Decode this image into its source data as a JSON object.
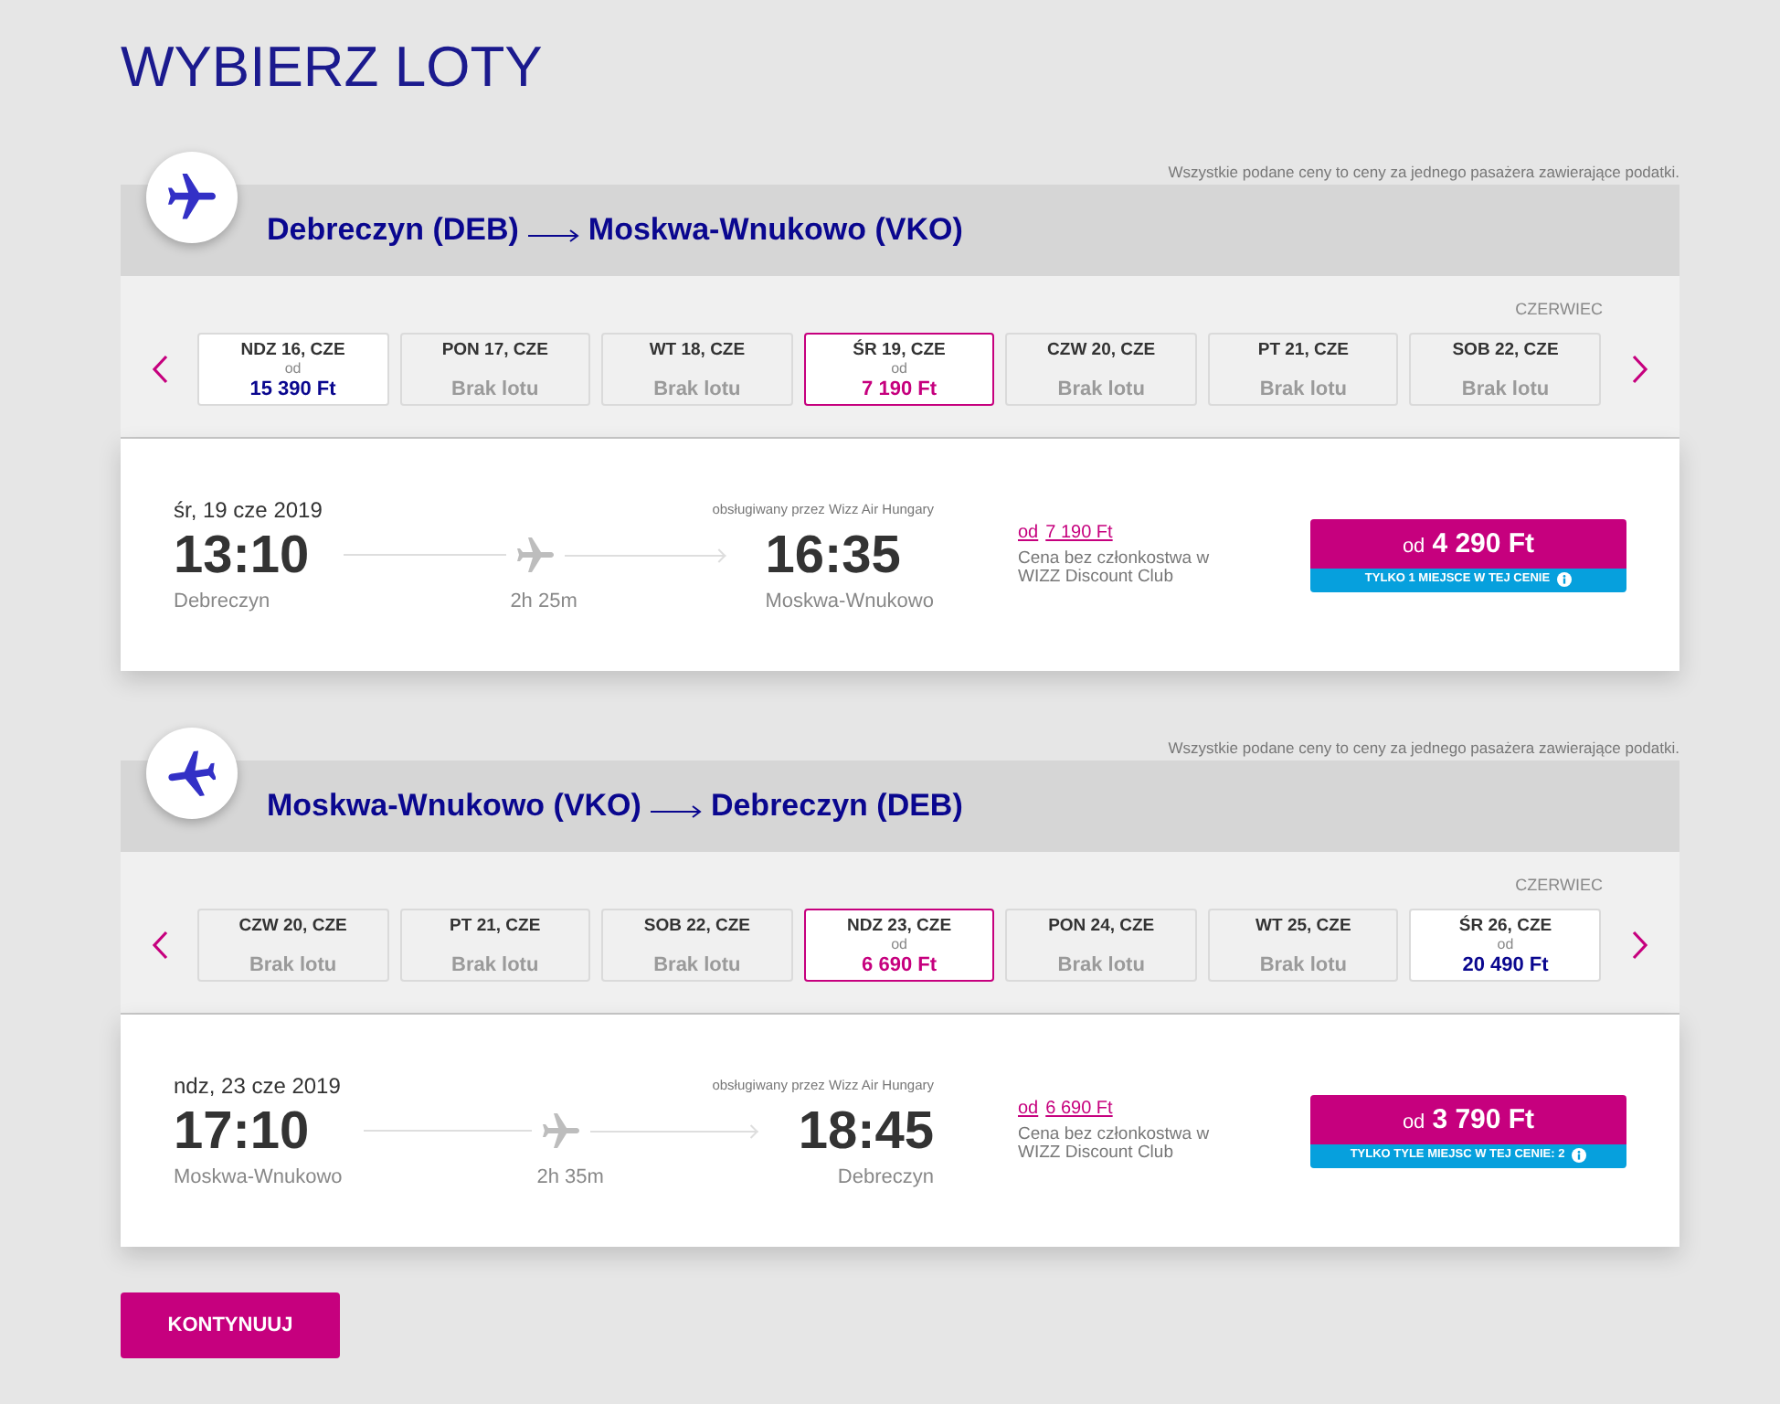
{
  "page_title": "WYBIERZ LOTY",
  "legs": [
    {
      "kind": "outbound",
      "price_note": "Wszystkie podane ceny to ceny za jednego pasażera zawierające podatki.",
      "origin": "Debreczyn (DEB)",
      "destination": "Moskwa-Wnukowo (VKO)",
      "month": "CZERWIEC",
      "dates": [
        {
          "kind": "fare",
          "day": "NDZ 16, CZE",
          "from": "od",
          "price": "15 390 Ft",
          "selected": false
        },
        {
          "kind": "no_flight",
          "day": "PON 17, CZE",
          "status": "Brak lotu",
          "selected": false
        },
        {
          "kind": "no_flight",
          "day": "WT 18, CZE",
          "status": "Brak lotu",
          "selected": false
        },
        {
          "kind": "fare",
          "day": "ŚR 19, CZE",
          "from": "od",
          "price": "7 190 Ft",
          "selected": true
        },
        {
          "kind": "no_flight",
          "day": "CZW 20, CZE",
          "status": "Brak lotu",
          "selected": false
        },
        {
          "kind": "no_flight",
          "day": "PT 21, CZE",
          "status": "Brak lotu",
          "selected": false
        },
        {
          "kind": "no_flight",
          "day": "SOB 22, CZE",
          "status": "Brak lotu",
          "selected": false
        }
      ],
      "flight": {
        "date": "śr, 19 cze 2019",
        "operator": "obsługiwany przez Wizz Air Hungary",
        "departure_time": "13:10",
        "departure_city": "Debreczyn",
        "duration": "2h 25m",
        "arrival_time": "16:35",
        "arrival_city": "Moskwa-Wnukowo",
        "member_from": "od",
        "member_price": "7 190 Ft",
        "member_note": "Cena bez członkostwa w WIZZ Discount Club",
        "fare_from": "od",
        "fare_price": "4 290 Ft",
        "seats_note": "TYLKO 1 MIEJSCE W TEJ CENIE"
      }
    },
    {
      "kind": "return",
      "price_note": "Wszystkie podane ceny to ceny za jednego pasażera zawierające podatki.",
      "origin": "Moskwa-Wnukowo (VKO)",
      "destination": "Debreczyn (DEB)",
      "month": "CZERWIEC",
      "dates": [
        {
          "kind": "no_flight",
          "day": "CZW 20, CZE",
          "status": "Brak lotu",
          "selected": false
        },
        {
          "kind": "no_flight",
          "day": "PT 21, CZE",
          "status": "Brak lotu",
          "selected": false
        },
        {
          "kind": "no_flight",
          "day": "SOB 22, CZE",
          "status": "Brak lotu",
          "selected": false
        },
        {
          "kind": "fare",
          "day": "NDZ 23, CZE",
          "from": "od",
          "price": "6 690 Ft",
          "selected": true
        },
        {
          "kind": "no_flight",
          "day": "PON 24, CZE",
          "status": "Brak lotu",
          "selected": false
        },
        {
          "kind": "no_flight",
          "day": "WT 25, CZE",
          "status": "Brak lotu",
          "selected": false
        },
        {
          "kind": "fare",
          "day": "ŚR 26, CZE",
          "from": "od",
          "price": "20 490 Ft",
          "selected": false
        }
      ],
      "flight": {
        "date": "ndz, 23 cze 2019",
        "operator": "obsługiwany przez Wizz Air Hungary",
        "departure_time": "17:10",
        "departure_city": "Moskwa-Wnukowo",
        "duration": "2h 35m",
        "arrival_time": "18:45",
        "arrival_city": "Debreczyn",
        "member_from": "od",
        "member_price": "6 690 Ft",
        "member_note": "Cena bez członkostwa w WIZZ Discount Club",
        "fare_from": "od",
        "fare_price": "3 790 Ft",
        "seats_note": "TYLKO TYLE MIEJSC W TEJ CENIE: 2"
      }
    }
  ],
  "continue_button": "KONTYNUUJ"
}
